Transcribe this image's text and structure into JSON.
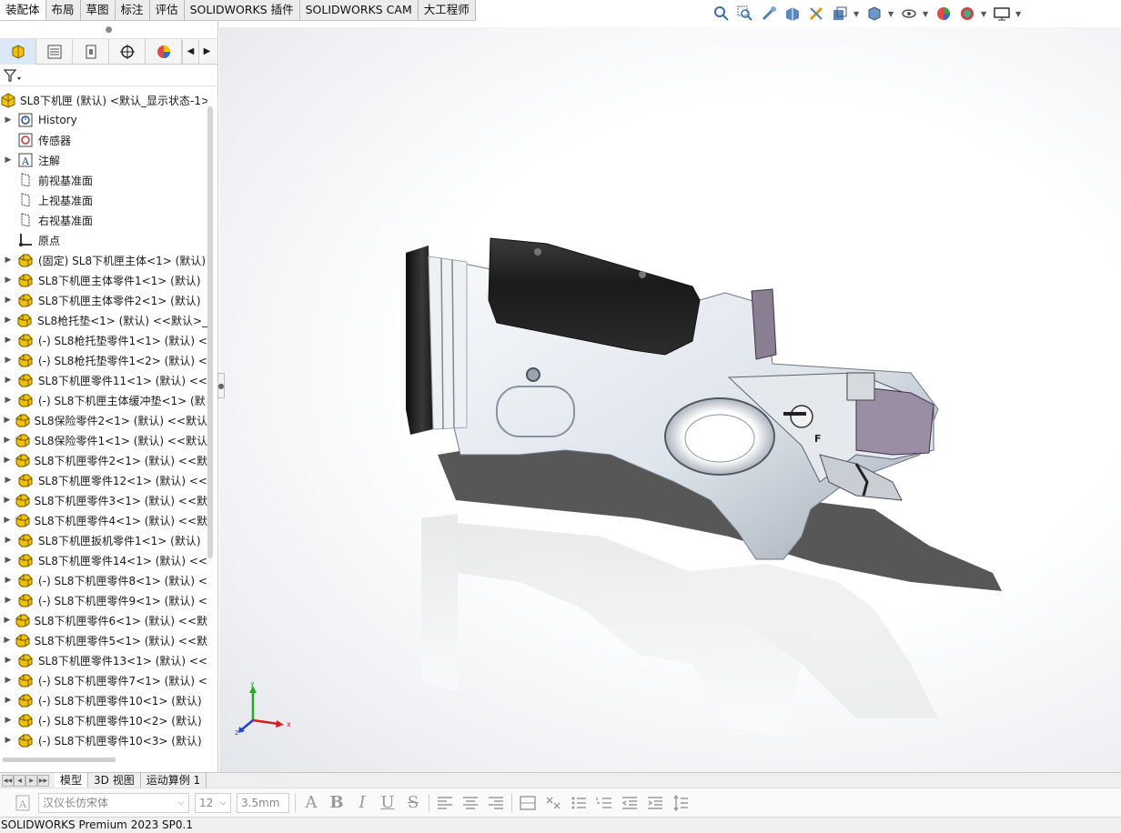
{
  "command_tabs": [
    "装配体",
    "布局",
    "草图",
    "标注",
    "评估",
    "SOLIDWORKS 插件",
    "SOLIDWORKS CAM",
    "大工程师"
  ],
  "active_command_tab": "装配体",
  "hud_icons": [
    "zoom-to-fit-icon",
    "zoom-to-area-icon",
    "previous-view-icon",
    "section-view-icon",
    "dynamic-annotation-icon",
    "display-style-icon",
    "view-orientation-icon",
    "hide-show-icon",
    "edit-appearance-icon",
    "apply-scene-icon",
    "view-settings-icon"
  ],
  "panel_tabs": [
    "featuremanager-icon",
    "propertymanager-icon",
    "configurationmanager-icon",
    "dimxpert-icon",
    "displaymanager-icon"
  ],
  "tree": {
    "root": "SL8下机匣 (默认) <默认_显示状态-1>",
    "folders": [
      {
        "label": "History",
        "icon": "history-folder-icon",
        "expandable": true
      },
      {
        "label": "传感器",
        "icon": "sensors-icon",
        "expandable": false
      },
      {
        "label": "注解",
        "icon": "annotations-icon",
        "expandable": true
      },
      {
        "label": "前视基准面",
        "icon": "plane-icon",
        "expandable": false
      },
      {
        "label": "上视基准面",
        "icon": "plane-icon",
        "expandable": false
      },
      {
        "label": "右视基准面",
        "icon": "plane-icon",
        "expandable": false
      },
      {
        "label": "原点",
        "icon": "origin-icon",
        "expandable": false
      }
    ],
    "components": [
      "(固定) SL8下机匣主体<1> (默认)",
      "SL8下机匣主体零件1<1> (默认)",
      "SL8下机匣主体零件2<1> (默认)",
      "SL8枪托垫<1> (默认) <<默认>_",
      "(-) SL8枪托垫零件1<1> (默认) <",
      "(-) SL8枪托垫零件1<2> (默认) <",
      "SL8下机匣零件11<1> (默认) <<",
      "(-) SL8下机匣主体缓冲垫<1> (默",
      "SL8保险零件2<1> (默认) <<默认",
      "SL8保险零件1<1> (默认) <<默认",
      "SL8下机匣零件2<1> (默认) <<默",
      "SL8下机匣零件12<1> (默认) <<",
      "SL8下机匣零件3<1> (默认) <<默",
      "SL8下机匣零件4<1> (默认) <<默",
      "SL8下机匣扳机零件1<1> (默认)",
      "SL8下机匣零件14<1> (默认) <<",
      "(-) SL8下机匣零件8<1> (默认) <",
      "(-) SL8下机匣零件9<1> (默认) <",
      "SL8下机匣零件6<1> (默认) <<默",
      "SL8下机匣零件5<1> (默认) <<默",
      "SL8下机匣零件13<1> (默认) <<",
      "(-) SL8下机匣零件7<1> (默认) <",
      "(-) SL8下机匣零件10<1> (默认)",
      "(-) SL8下机匣零件10<2> (默认)",
      "(-) SL8下机匣零件10<3> (默认)"
    ]
  },
  "triad": {
    "x": "x",
    "y": "y",
    "z": "z"
  },
  "bottom_tabs": [
    "模型",
    "3D 视图",
    "运动算例 1"
  ],
  "active_bottom_tab": "模型",
  "format_bar": {
    "font": "汉仪长仿宋体",
    "size": "12",
    "height": "3.5mm"
  },
  "status": "SOLIDWORKS Premium 2023 SP0.1",
  "colors": {
    "part_icon": "#f2c200",
    "model_white": "#e9eef3",
    "model_black": "#1c1c1c",
    "shadow": "#3a3a3a"
  }
}
